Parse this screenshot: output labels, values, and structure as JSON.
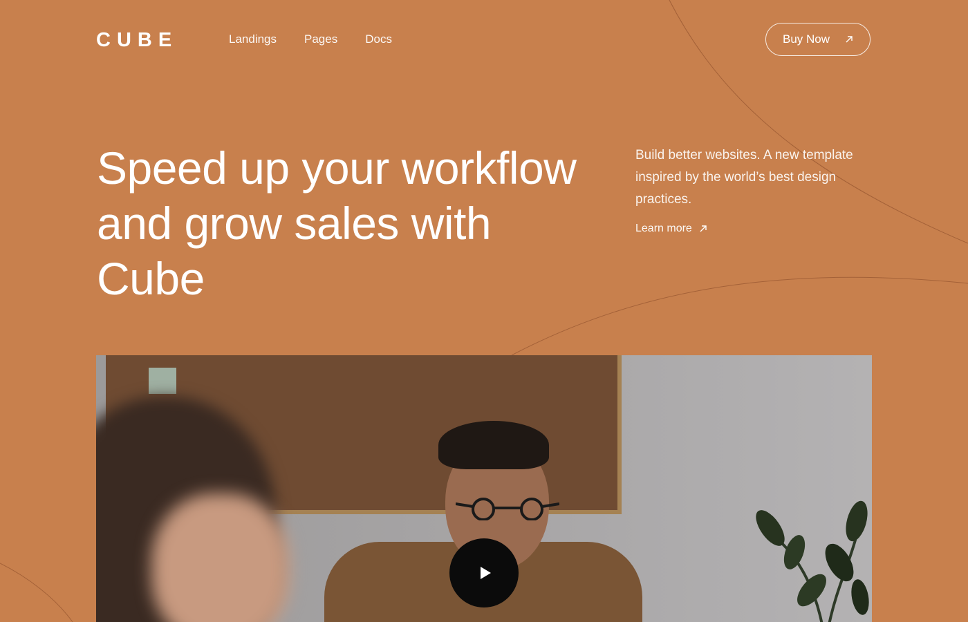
{
  "brand": {
    "logo": "CUBE"
  },
  "nav": {
    "items": [
      {
        "label": "Landings"
      },
      {
        "label": "Pages"
      },
      {
        "label": "Docs"
      }
    ]
  },
  "header": {
    "buy_label": "Buy Now"
  },
  "hero": {
    "title": "Speed up your workflow and grow sales with Cube",
    "description": "Build better websites. A new template inspired by the world’s best design practices.",
    "learn_more": "Learn more"
  },
  "colors": {
    "background": "#c8804d",
    "text": "#ffffff",
    "play_button": "#0b0b0b"
  },
  "icons": {
    "buy_now": "arrow-up-right-icon",
    "learn_more": "arrow-up-right-icon",
    "video": "play-icon"
  }
}
